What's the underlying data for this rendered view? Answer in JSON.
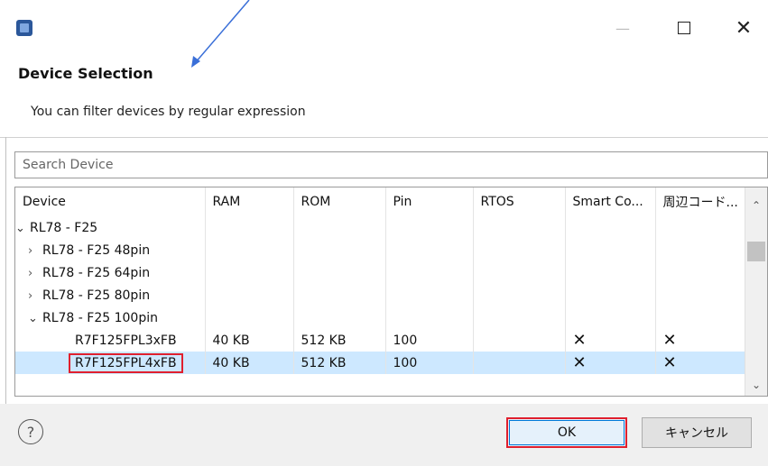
{
  "window": {
    "icon": "app-chip-icon",
    "minimize_icon": "minimize-icon",
    "maximize_icon": "maximize-icon",
    "close_label": "✕"
  },
  "header": {
    "title": "Device Selection",
    "subtitle": "You can filter devices by regular expression"
  },
  "search": {
    "placeholder": "Search Device",
    "value": ""
  },
  "table": {
    "columns": [
      "Device",
      "RAM",
      "ROM",
      "Pin",
      "RTOS",
      "Smart Co...",
      "周辺コード..."
    ],
    "rows": [
      {
        "device": "RL78 - F25",
        "expander": "⌄",
        "ram": "",
        "rom": "",
        "pin": "",
        "rtos": "",
        "smart": "",
        "peri": ""
      },
      {
        "device": "RL78 - F25 48pin",
        "expander": "›",
        "ram": "",
        "rom": "",
        "pin": "",
        "rtos": "",
        "smart": "",
        "peri": ""
      },
      {
        "device": "RL78 - F25 64pin",
        "expander": "›",
        "ram": "",
        "rom": "",
        "pin": "",
        "rtos": "",
        "smart": "",
        "peri": ""
      },
      {
        "device": "RL78 - F25 80pin",
        "expander": "›",
        "ram": "",
        "rom": "",
        "pin": "",
        "rtos": "",
        "smart": "",
        "peri": ""
      },
      {
        "device": "RL78 - F25 100pin",
        "expander": "⌄",
        "ram": "",
        "rom": "",
        "pin": "",
        "rtos": "",
        "smart": "",
        "peri": ""
      },
      {
        "device": "R7F125FPL3xFB",
        "expander": "",
        "ram": "40 KB",
        "rom": "512 KB",
        "pin": "100",
        "rtos": "",
        "smart": "✕",
        "peri": "✕"
      },
      {
        "device": "R7F125FPL4xFB",
        "expander": "",
        "ram": "40 KB",
        "rom": "512 KB",
        "pin": "100",
        "rtos": "",
        "smart": "✕",
        "peri": "✕",
        "selected": true
      }
    ]
  },
  "scrollbar": {
    "up_label": "⌃",
    "down_label": "⌄"
  },
  "footer": {
    "help_label": "?",
    "ok_label": "OK",
    "cancel_label": "キャンセル"
  },
  "colors": {
    "highlight": "#e0202e",
    "selection": "#cde8ff",
    "annotation_arrow": "#3a6fd8"
  }
}
